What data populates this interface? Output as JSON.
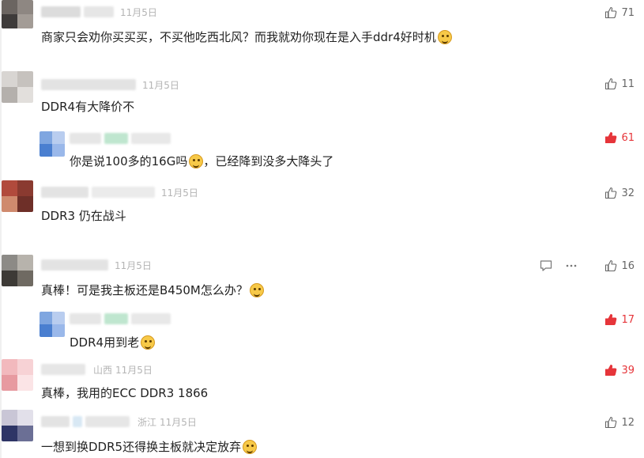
{
  "comments": [
    {
      "date": "11月5日",
      "text": "商家只会劝你买买买，不买他吃西北风？而我就劝你现在是入手ddr4好时机",
      "likes": "71",
      "emoji": "cat-face"
    },
    {
      "date": "11月5日",
      "text": "DDR4有大降价不",
      "likes": "11"
    },
    {
      "date": "",
      "text": "你是说100多的16G吗",
      "text2": "，已经降到没多大降头了",
      "likes": "61",
      "emoji": "cat-face",
      "hot": true
    },
    {
      "date": "11月5日",
      "text": "DDR3 仍在战斗",
      "likes": "32"
    },
    {
      "date": "11月5日",
      "text": "真棒！可是我主板还是B450M怎么办？",
      "likes": "16",
      "emoji": "grin-face"
    },
    {
      "date": "",
      "text": "DDR4用到老",
      "likes": "17",
      "emoji": "cat-face",
      "hot": true
    },
    {
      "location": "山西",
      "date": "11月5日",
      "text": "真棒，我用的ECC DDR3 1866",
      "likes": "39",
      "hot": true
    },
    {
      "location": "浙江",
      "date": "11月5日",
      "text": "一想到换DDR5还得换主板就决定放弃",
      "likes": "12",
      "emoji": "sad-face"
    }
  ],
  "icons": {
    "like": "thumbs-up-icon",
    "reply": "comment-icon",
    "more": "more-dots-icon"
  },
  "colors": {
    "like_active": "#e6353a",
    "like_default": "#666666",
    "date": "#b4b4b4"
  }
}
